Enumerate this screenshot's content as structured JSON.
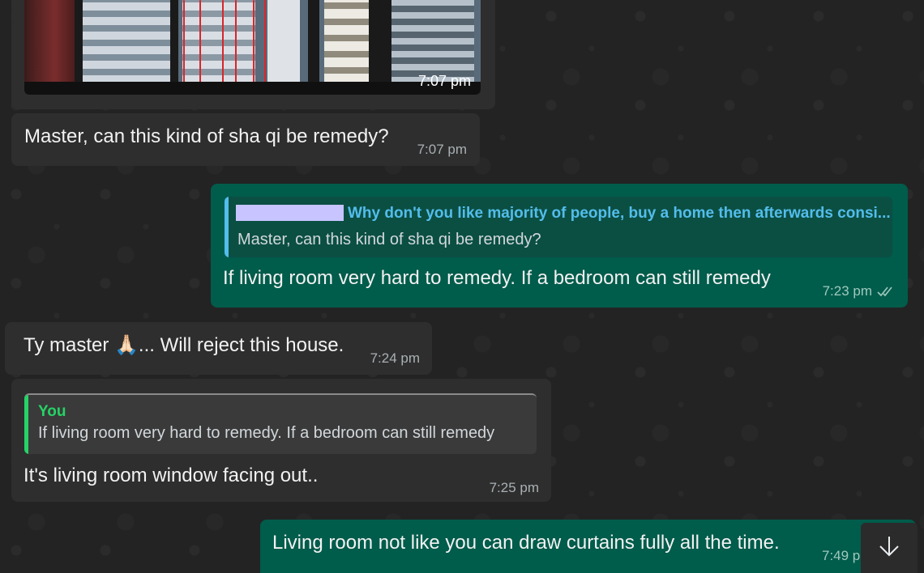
{
  "messages": {
    "m1": {
      "time": "7:07 pm"
    },
    "m2": {
      "text": "Master, can this kind of sha qi be remedy?",
      "time": "7:07 pm"
    },
    "m3": {
      "quote_author": "Why don't you like majority of people, buy a home then afterwards consi...",
      "quote_text": "Master, can this kind of sha qi be remedy?",
      "text": "If living room very hard to remedy. If a bedroom can still remedy",
      "time": "7:23 pm",
      "status_icon": "double-check-icon"
    },
    "m4": {
      "text": "Ty master 🙏🏻... Will reject this house.",
      "time": "7:24 pm"
    },
    "m5": {
      "quote_author": "You",
      "quote_text": "If living room very hard to remedy. If a bedroom can still remedy",
      "text": "It's living room window facing out..",
      "time": "7:25 pm"
    },
    "m6": {
      "text": "Living room not like you can draw curtains fully all the time.",
      "time": "7:49 p"
    }
  },
  "colors": {
    "incoming_bubble": "#2e2e2e",
    "outgoing_bubble": "#005c4b",
    "quote_accent_outgoing": "#53bdeb",
    "quote_accent_incoming": "#25d366",
    "redaction": "#c8c4ff"
  },
  "icons": {
    "scroll_down": "arrow-down-icon",
    "read_receipt": "double-check-icon"
  }
}
